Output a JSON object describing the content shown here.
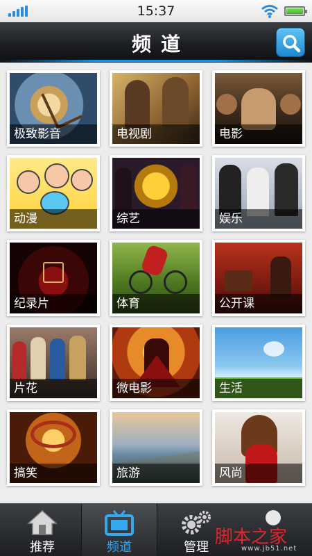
{
  "status": {
    "time": "15:37"
  },
  "header": {
    "title": "频道"
  },
  "channels": [
    {
      "label": "极致影音",
      "icon": "clock-art"
    },
    {
      "label": "电视剧",
      "icon": "tv-drama-art"
    },
    {
      "label": "电影",
      "icon": "movie-art"
    },
    {
      "label": "动漫",
      "icon": "anime-art"
    },
    {
      "label": "综艺",
      "icon": "variety-art"
    },
    {
      "label": "娱乐",
      "icon": "entertainment-art"
    },
    {
      "label": "纪录片",
      "icon": "documentary-art"
    },
    {
      "label": "体育",
      "icon": "sports-art"
    },
    {
      "label": "公开课",
      "icon": "open-class-art"
    },
    {
      "label": "片花",
      "icon": "trailer-art"
    },
    {
      "label": "微电影",
      "icon": "micro-film-art"
    },
    {
      "label": "生活",
      "icon": "life-art"
    },
    {
      "label": "搞笑",
      "icon": "funny-art"
    },
    {
      "label": "旅游",
      "icon": "travel-art"
    },
    {
      "label": "风尚",
      "icon": "fashion-art"
    }
  ],
  "tabs": [
    {
      "label": "推荐",
      "icon": "home-icon"
    },
    {
      "label": "频道",
      "icon": "tv-icon",
      "active": true
    },
    {
      "label": "管理",
      "icon": "gear-icon"
    },
    {
      "label": "",
      "icon": "user-icon"
    }
  ],
  "watermark": {
    "text": "脚本之家",
    "sub": "www.jb51.net"
  },
  "colors": {
    "accent": "#35a8ee",
    "header_bg": "#1b1d21"
  }
}
